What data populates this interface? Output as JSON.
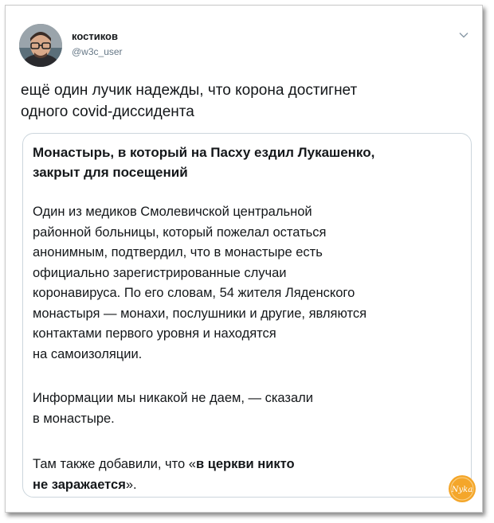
{
  "tweet": {
    "author_name": "костиков",
    "author_handle": "@w3c_user",
    "text_line1": "ещё один лучик надежды, что корона достигнет",
    "text_line2": "одного covid-диссидента"
  },
  "card": {
    "title_line1": "Монастырь, в который на Пасху ездил Лукашенко,",
    "title_line2": "закрыт для посещений",
    "paragraph1_lines": [
      "Один из медиков Смолевичской центральной",
      "районной больницы, который пожелал остаться",
      "анонимным, подтвердил, что в монастыре есть",
      "официально зарегистрированные случаи",
      "коронавируса. По его словам, 54 жителя Ляденского",
      "монастыря — монахи, послушники и другие, являются",
      "контактами первого уровня и находятся",
      "на самоизоляции."
    ],
    "paragraph2_lines": [
      "Информации мы никакой не даем, — сказали",
      "в монастыре."
    ],
    "paragraph3": {
      "line1_prefix": "Там также добавили, что «",
      "line1_bold": "в церкви никто",
      "line2_bold": "не заражается",
      "line2_suffix": "»."
    }
  },
  "watermark": {
    "text": "Nyka",
    "color": "#f4a62a"
  },
  "icons": {
    "menu": "chevron-down-icon",
    "watermark": "watermark-logo"
  }
}
